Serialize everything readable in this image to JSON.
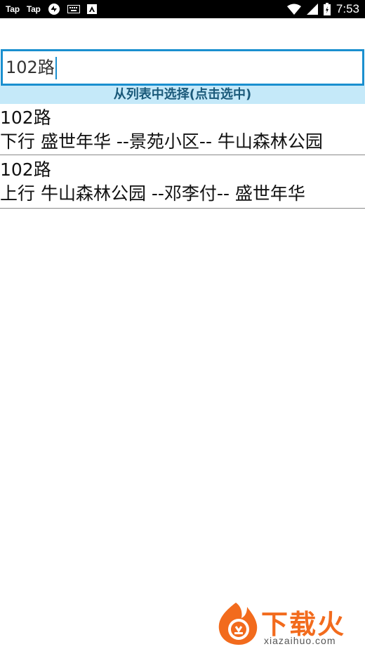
{
  "status_bar": {
    "left_items": [
      "Tap",
      "Tap"
    ],
    "time": "7:53"
  },
  "search": {
    "value": "102路"
  },
  "hint": {
    "text": "从列表中选择(点击选中)"
  },
  "routes": [
    {
      "name": "102路",
      "description": "下行 盛世年华 --景苑小区-- 牛山森林公园"
    },
    {
      "name": "102路",
      "description": "上行 牛山森林公园 --邓李付-- 盛世年华"
    }
  ],
  "watermark": {
    "brand": "下载火",
    "domain": "xiazaihuo.com"
  },
  "colors": {
    "accent": "#1a8fcf",
    "hint_background": "#c5e9f9",
    "hint_text": "#1b5a7a",
    "watermark": "#f26b1d"
  }
}
